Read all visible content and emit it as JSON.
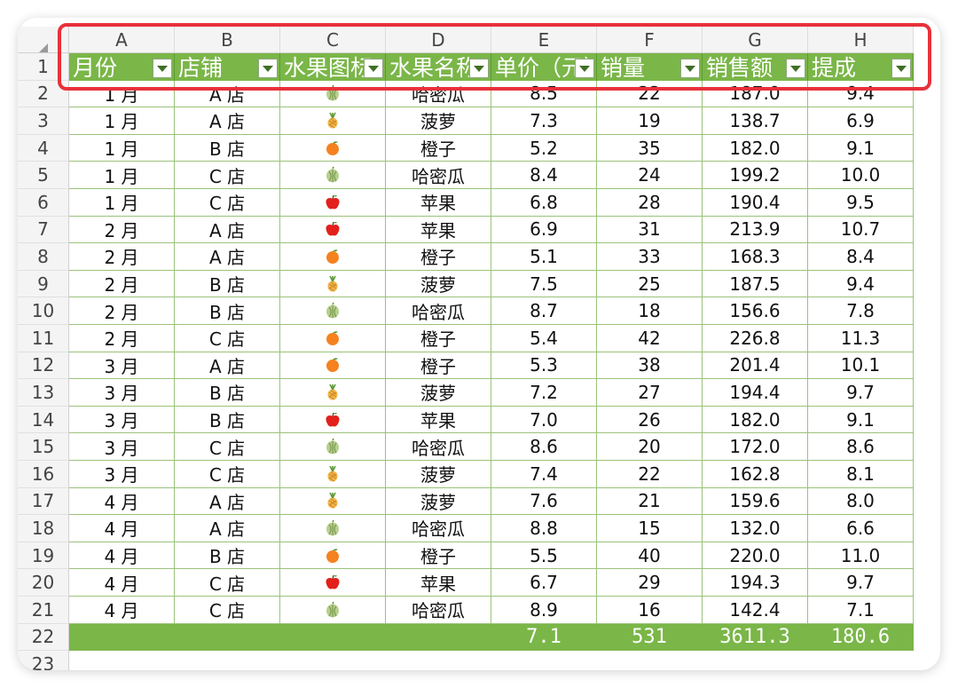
{
  "columns": [
    "A",
    "B",
    "C",
    "D",
    "E",
    "F",
    "G",
    "H"
  ],
  "row_numbers": [
    "1",
    "2",
    "3",
    "4",
    "5",
    "6",
    "7",
    "8",
    "9",
    "10",
    "11",
    "12",
    "13",
    "14",
    "15",
    "16",
    "17",
    "18",
    "19",
    "20",
    "21",
    "22",
    "23"
  ],
  "table_headers": [
    "月份",
    "店铺",
    "水果图标",
    "水果名称",
    "单价（元）",
    "销量",
    "销售额",
    "提成"
  ],
  "rows": [
    [
      "1 月",
      "A 店",
      "melon",
      "哈密瓜",
      "8.5",
      "22",
      "187.0",
      "9.4"
    ],
    [
      "1 月",
      "A 店",
      "pineapple",
      "菠萝",
      "7.3",
      "19",
      "138.7",
      "6.9"
    ],
    [
      "1 月",
      "B 店",
      "orange",
      "橙子",
      "5.2",
      "35",
      "182.0",
      "9.1"
    ],
    [
      "1 月",
      "C 店",
      "melon",
      "哈密瓜",
      "8.4",
      "24",
      "199.2",
      "10.0"
    ],
    [
      "1 月",
      "C 店",
      "apple",
      "苹果",
      "6.8",
      "28",
      "190.4",
      "9.5"
    ],
    [
      "2 月",
      "A 店",
      "apple",
      "苹果",
      "6.9",
      "31",
      "213.9",
      "10.7"
    ],
    [
      "2 月",
      "A 店",
      "orange",
      "橙子",
      "5.1",
      "33",
      "168.3",
      "8.4"
    ],
    [
      "2 月",
      "B 店",
      "pineapple",
      "菠萝",
      "7.5",
      "25",
      "187.5",
      "9.4"
    ],
    [
      "2 月",
      "B 店",
      "melon",
      "哈密瓜",
      "8.7",
      "18",
      "156.6",
      "7.8"
    ],
    [
      "2 月",
      "C 店",
      "orange",
      "橙子",
      "5.4",
      "42",
      "226.8",
      "11.3"
    ],
    [
      "3 月",
      "A 店",
      "orange",
      "橙子",
      "5.3",
      "38",
      "201.4",
      "10.1"
    ],
    [
      "3 月",
      "B 店",
      "pineapple",
      "菠萝",
      "7.2",
      "27",
      "194.4",
      "9.7"
    ],
    [
      "3 月",
      "B 店",
      "apple",
      "苹果",
      "7.0",
      "26",
      "182.0",
      "9.1"
    ],
    [
      "3 月",
      "C 店",
      "melon",
      "哈密瓜",
      "8.6",
      "20",
      "172.0",
      "8.6"
    ],
    [
      "3 月",
      "C 店",
      "pineapple",
      "菠萝",
      "7.4",
      "22",
      "162.8",
      "8.1"
    ],
    [
      "4 月",
      "A 店",
      "pineapple",
      "菠萝",
      "7.6",
      "21",
      "159.6",
      "8.0"
    ],
    [
      "4 月",
      "A 店",
      "melon",
      "哈密瓜",
      "8.8",
      "15",
      "132.0",
      "6.6"
    ],
    [
      "4 月",
      "B 店",
      "orange",
      "橙子",
      "5.5",
      "40",
      "220.0",
      "11.0"
    ],
    [
      "4 月",
      "C 店",
      "apple",
      "苹果",
      "6.7",
      "29",
      "194.3",
      "9.7"
    ],
    [
      "4 月",
      "C 店",
      "melon",
      "哈密瓜",
      "8.9",
      "16",
      "142.4",
      "7.1"
    ]
  ],
  "totals": [
    "",
    "",
    "",
    "",
    "7.1",
    "531",
    "3611.3",
    "180.6"
  ],
  "colors": {
    "header_green": "#7ab648",
    "highlight_red": "#e8313a",
    "border_green": "#9bc27a"
  },
  "fruit_icons": {
    "melon": "melon-icon",
    "pineapple": "pineapple-icon",
    "orange": "orange-icon",
    "apple": "apple-icon"
  }
}
